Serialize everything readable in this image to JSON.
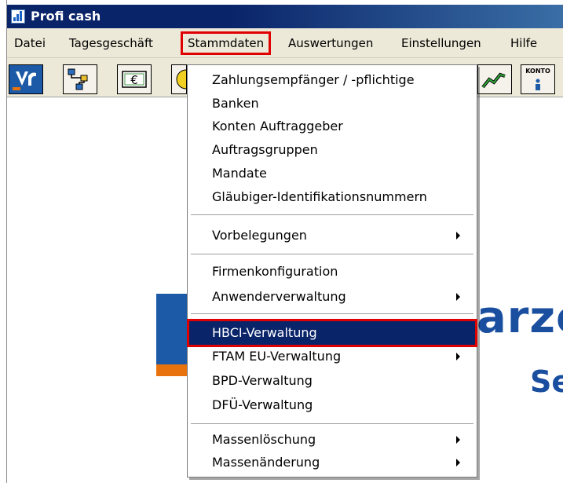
{
  "window": {
    "title": "Profi cash"
  },
  "menubar": {
    "items": [
      {
        "label": "Datei"
      },
      {
        "label": "Tagesgeschäft"
      },
      {
        "label": "Stammdaten"
      },
      {
        "label": "Auswertungen"
      },
      {
        "label": "Einstellungen"
      },
      {
        "label": "Hilfe"
      }
    ]
  },
  "toolbar": {
    "konto_label": "KONTO"
  },
  "background": {
    "brand_partial": "arze",
    "brand_sub_partial": "Ser"
  },
  "dropdown": {
    "items": [
      {
        "label": "Zahlungsempfänger / -pflichtige"
      },
      {
        "label": "Banken"
      },
      {
        "label": "Konten Auftraggeber"
      },
      {
        "label": "Auftragsgruppen"
      },
      {
        "label": "Mandate"
      },
      {
        "label": "Gläubiger-Identifikationsnummern"
      },
      {
        "label": "Vorbelegungen"
      },
      {
        "label": "Firmenkonfiguration"
      },
      {
        "label": "Anwenderverwaltung"
      },
      {
        "label": "HBCI-Verwaltung"
      },
      {
        "label": "FTAM EU-Verwaltung"
      },
      {
        "label": "BPD-Verwaltung"
      },
      {
        "label": "DFÜ-Verwaltung"
      },
      {
        "label": "Massenlöschung"
      },
      {
        "label": "Massenänderung"
      }
    ]
  }
}
